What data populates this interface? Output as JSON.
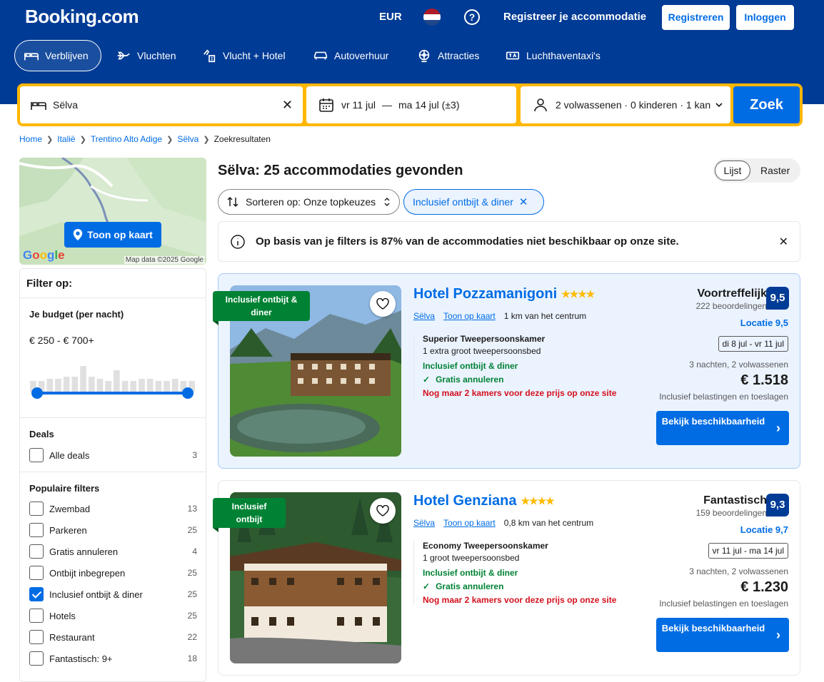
{
  "header": {
    "logo": "Booking.com",
    "currency": "EUR",
    "help_label": "?",
    "register_property": "Registreer je accommodatie",
    "register_button": "Registreren",
    "login_button": "Inloggen"
  },
  "nav": [
    {
      "label": "Verblijven",
      "icon": "bed-icon",
      "active": true
    },
    {
      "label": "Vluchten",
      "icon": "plane-icon"
    },
    {
      "label": "Vlucht + Hotel",
      "icon": "flight-hotel-icon"
    },
    {
      "label": "Autoverhuur",
      "icon": "car-icon"
    },
    {
      "label": "Attracties",
      "icon": "attractions-icon"
    },
    {
      "label": "Luchthaventaxi's",
      "icon": "taxi-icon"
    }
  ],
  "search": {
    "destination": "Sëlva",
    "date_from": "vr 11 jul",
    "date_sep": "—",
    "date_to": "ma 14 jul (±3)",
    "guests": "2 volwassenen · 0 kinderen · 1 kan",
    "submit": "Zoek"
  },
  "breadcrumb": [
    "Home",
    "Italië",
    "Trentino Alto Adige",
    "Sëlva",
    "Zoekresultaten"
  ],
  "map": {
    "button": "Toon op kaart",
    "google": "Google",
    "attribution": "Map data ©2025 Google"
  },
  "filters": {
    "title": "Filter op:",
    "budget_title": "Je budget (per nacht)",
    "budget_range": "€ 250 - € 700+",
    "budget_histogram": [
      0.25,
      0.25,
      0.3,
      0.3,
      0.35,
      0.35,
      0.6,
      0.35,
      0.3,
      0.25,
      0.5,
      0.25,
      0.25,
      0.3,
      0.3,
      0.25,
      0.25,
      0.3,
      0.25,
      0.25
    ],
    "budget_bar_color": "#e0e0e0",
    "slider_color": "#006ce4",
    "deals_title": "Deals",
    "deals": [
      {
        "label": "Alle deals",
        "count": "3",
        "checked": false
      }
    ],
    "popular_title": "Populaire filters",
    "popular": [
      {
        "label": "Zwembad",
        "count": "13",
        "checked": false
      },
      {
        "label": "Parkeren",
        "count": "25",
        "checked": false
      },
      {
        "label": "Gratis annuleren",
        "count": "4",
        "checked": false
      },
      {
        "label": "Ontbijt inbegrepen",
        "count": "25",
        "checked": false
      },
      {
        "label": "Inclusief ontbijt & diner",
        "count": "25",
        "checked": true
      },
      {
        "label": "Hotels",
        "count": "25",
        "checked": false
      },
      {
        "label": "Restaurant",
        "count": "22",
        "checked": false
      },
      {
        "label": "Fantastisch: 9+",
        "count": "18",
        "checked": false
      }
    ]
  },
  "results": {
    "title": "Sëlva: 25 accommodaties gevonden",
    "view_list": "Lijst",
    "view_grid": "Raster",
    "sort_label": "Sorteren op: Onze topkeuzes",
    "active_filter": "Inclusief ontbijt & diner",
    "notice": "Op basis van je filters is 87% van de accommodaties niet beschikbaar op onze site."
  },
  "hotels": [
    {
      "badge": "Inclusief ontbijt & diner",
      "name": "Hotel Pozzamanigoni",
      "stars": "★★★★",
      "location_link": "Sëlva",
      "map_link": "Toon op kaart",
      "distance": "1 km van het centrum",
      "room_type": "Superior Tweepersoonskamer",
      "bed": "1 extra groot tweepersoonsbed",
      "meal": "Inclusief ontbijt & diner",
      "cancel": "Gratis annuleren",
      "scarcity": "Nog maar 2 kamers voor deze prijs op onze site",
      "rating_word": "Voortreffelijk",
      "reviews": "222 beoordelingen",
      "score": "9,5",
      "location_score": "Locatie 9,5",
      "dates": "di 8 jul - vr 11 jul",
      "stay": "3 nachten, 2 volwassenen",
      "price": "€ 1.518",
      "tax_note": "Inclusief belastingen en toeslagen",
      "cta": "Bekijk beschikbaarheid"
    },
    {
      "badge": "Inclusief ontbijt",
      "name": "Hotel Genziana",
      "stars": "★★★★",
      "location_link": "Sëlva",
      "map_link": "Toon op kaart",
      "distance": "0,8 km van het centrum",
      "room_type": "Economy Tweepersoonskamer",
      "bed": "1 groot tweepersoonsbed",
      "meal": "Inclusief ontbijt & diner",
      "cancel": "Gratis annuleren",
      "scarcity": "Nog maar 2 kamers voor deze prijs op onze site",
      "rating_word": "Fantastisch",
      "reviews": "159 beoordelingen",
      "score": "9,3",
      "location_score": "Locatie 9,7",
      "dates": "vr 11 jul - ma 14 jul",
      "stay": "3 nachten, 2 volwassenen",
      "price": "€ 1.230",
      "tax_note": "Inclusief belastingen en toeslagen",
      "cta": "Bekijk beschikbaarheid"
    }
  ],
  "colors": {
    "brand_blue": "#003b95",
    "action_blue": "#006ce4",
    "search_yellow": "#ffb700",
    "green": "#008234",
    "red": "#d4111e"
  }
}
